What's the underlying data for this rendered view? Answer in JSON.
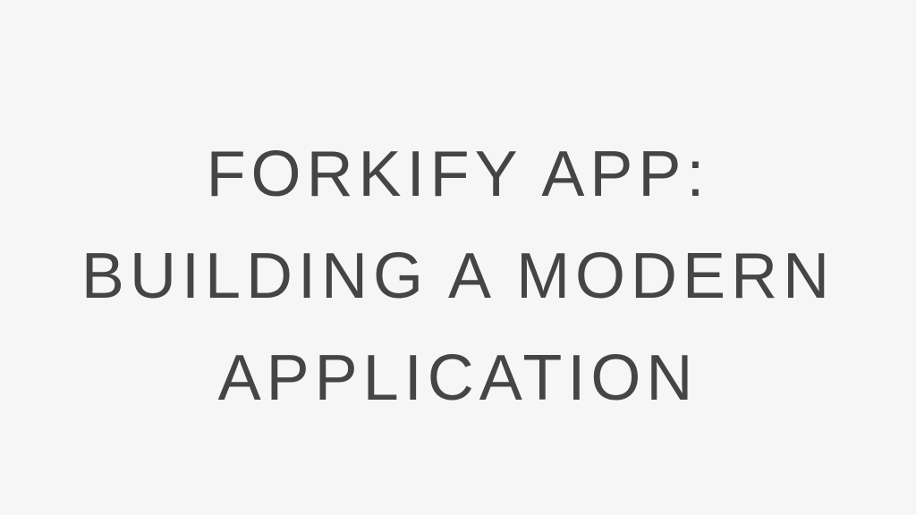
{
  "title": {
    "lines": [
      "FORKIFY APP:",
      "BUILDING A MODERN",
      "APPLICATION"
    ]
  },
  "colors": {
    "background": "#f6f6f6",
    "text": "#454545"
  }
}
